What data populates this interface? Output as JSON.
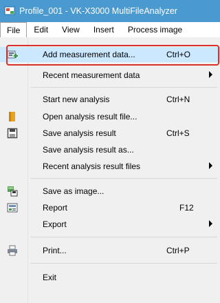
{
  "window": {
    "title": "Profile_001 - VK-X3000 MultiFileAnalyzer",
    "title_bg": "#4a9ad0"
  },
  "menubar": {
    "items": [
      {
        "label": "File",
        "open": true
      },
      {
        "label": "Edit"
      },
      {
        "label": "View"
      },
      {
        "label": "Insert"
      },
      {
        "label": "Process image"
      }
    ]
  },
  "file_menu": {
    "items": [
      {
        "label": "Add measurement data...",
        "shortcut": "Ctrl+O",
        "icon": "add-data-icon",
        "highlighted": true
      },
      {
        "label": "Recent measurement data",
        "submenu": true
      },
      {
        "label": "Start new analysis",
        "shortcut": "Ctrl+N"
      },
      {
        "label": "Open analysis result file...",
        "icon": "folder-icon"
      },
      {
        "label": "Save analysis result",
        "shortcut": "Ctrl+S",
        "icon": "save-icon"
      },
      {
        "label": "Save analysis result as..."
      },
      {
        "label": "Recent analysis result files",
        "submenu": true
      },
      {
        "label": "Save as image...",
        "icon": "save-image-icon"
      },
      {
        "label": "Report",
        "shortcut": "F12",
        "icon": "report-icon"
      },
      {
        "label": "Export",
        "submenu": true
      },
      {
        "label": "Print...",
        "shortcut": "Ctrl+P",
        "icon": "printer-icon"
      },
      {
        "label": "Exit"
      }
    ]
  },
  "colors": {
    "highlight_bg": "#cce8ff",
    "callout_border": "#d9302a"
  }
}
